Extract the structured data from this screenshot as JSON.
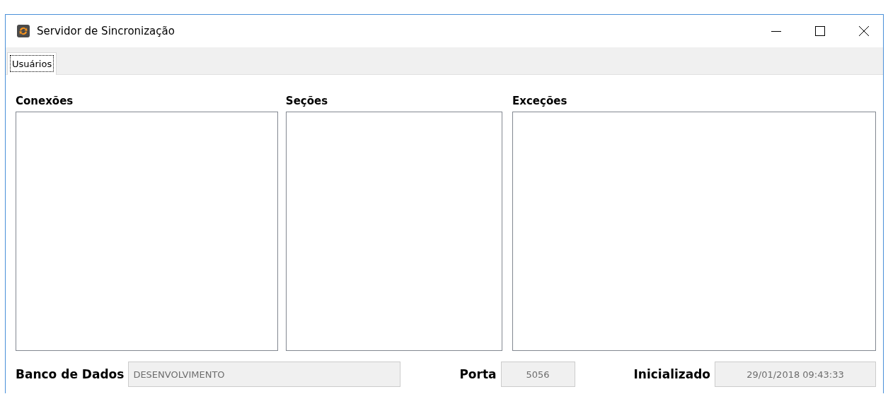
{
  "window": {
    "title": "Servidor de Sincronização"
  },
  "tabs": [
    {
      "label": "Usuários",
      "selected": true
    }
  ],
  "lists": [
    {
      "label": "Conexões"
    },
    {
      "label": "Seções"
    },
    {
      "label": "Exceções"
    }
  ],
  "fields": [
    {
      "label": "Banco de Dados",
      "value": "DESENVOLVIMENTO",
      "disabled": true,
      "kind": "wide"
    },
    {
      "label": "Porta",
      "value": "5056",
      "disabled": true,
      "kind": "narrow"
    },
    {
      "label": "Inicializado",
      "value": "29/01/2018 09:43:33",
      "disabled": true,
      "kind": "medium"
    }
  ]
}
